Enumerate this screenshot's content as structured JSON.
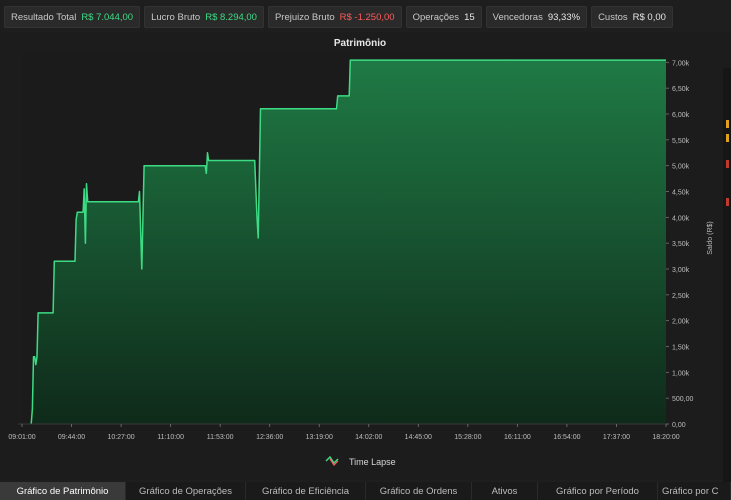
{
  "stats": [
    {
      "label": "Resultado Total",
      "value": "R$ 7.044,00",
      "tone": "pos"
    },
    {
      "label": "Lucro Bruto",
      "value": "R$ 8.294,00",
      "tone": "pos"
    },
    {
      "label": "Prejuizo Bruto",
      "value": "R$ -1.250,00",
      "tone": "neg"
    },
    {
      "label": "Operações",
      "value": "15",
      "tone": "neu"
    },
    {
      "label": "Vencedoras",
      "value": "93,33%",
      "tone": "neu"
    },
    {
      "label": "Custos",
      "value": "R$ 0,00",
      "tone": "neu"
    }
  ],
  "chart": {
    "title": "Patrimônio",
    "ylabel": "Saldo (R$)",
    "legend": "Time Lapse"
  },
  "chart_data": {
    "type": "area",
    "title": "Patrimônio",
    "xlabel": "",
    "ylabel": "Saldo (R$)",
    "ylim": [
      0,
      7200
    ],
    "y_ticks": [
      0,
      500,
      1000,
      1500,
      2000,
      2500,
      3000,
      3500,
      4000,
      4500,
      5000,
      5500,
      6000,
      6500,
      7000
    ],
    "y_tick_labels": [
      "0,00",
      "500,00",
      "1,00k",
      "1,50k",
      "2,00k",
      "2,50k",
      "3,00k",
      "3,50k",
      "4,00k",
      "4,50k",
      "5,00k",
      "5,50k",
      "6,00k",
      "6,50k",
      "7,00k"
    ],
    "x_tick_labels": [
      "09:01:00",
      "09:44:00",
      "10:27:00",
      "11:10:00",
      "11:53:00",
      "12:36:00",
      "13:19:00",
      "14:02:00",
      "14:45:00",
      "15:28:00",
      "16:11:00",
      "16:54:00",
      "17:37:00",
      "18:20:00"
    ],
    "x_tick_minutes": [
      541,
      584,
      627,
      670,
      713,
      756,
      799,
      842,
      885,
      928,
      971,
      1014,
      1057,
      1100
    ],
    "xlim_minutes": [
      541,
      1100
    ],
    "series": [
      {
        "name": "Time Lapse",
        "color": "#3ddc84",
        "points": [
          [
            549,
            0
          ],
          [
            550,
            300
          ],
          [
            551,
            1300
          ],
          [
            552,
            1300
          ],
          [
            553,
            1150
          ],
          [
            554,
            1300
          ],
          [
            555,
            2150
          ],
          [
            568,
            2150
          ],
          [
            569,
            3150
          ],
          [
            587,
            3150
          ],
          [
            588,
            3950
          ],
          [
            589,
            4100
          ],
          [
            594,
            4100
          ],
          [
            595,
            4550
          ],
          [
            596,
            3500
          ],
          [
            597,
            4650
          ],
          [
            598,
            4300
          ],
          [
            642,
            4300
          ],
          [
            643,
            4500
          ],
          [
            645,
            3000
          ],
          [
            647,
            5000
          ],
          [
            700,
            5000
          ],
          [
            701,
            4850
          ],
          [
            702,
            5250
          ],
          [
            703,
            5100
          ],
          [
            743,
            5100
          ],
          [
            745,
            4000
          ],
          [
            746,
            3600
          ],
          [
            748,
            6100
          ],
          [
            814,
            6100
          ],
          [
            815,
            6350
          ],
          [
            825,
            6350
          ],
          [
            826,
            7044
          ],
          [
            1100,
            7044
          ]
        ]
      }
    ],
    "grid": false,
    "legend_position": "bottom-center"
  },
  "tabs": [
    {
      "label": "Gráfico de Patrimônio",
      "active": true
    },
    {
      "label": "Gráfico de Operações",
      "active": false
    },
    {
      "label": "Gráfico de Eficiência",
      "active": false
    },
    {
      "label": "Gráfico de Ordens",
      "active": false
    },
    {
      "label": "Ativos",
      "active": false
    },
    {
      "label": "Gráfico por Período",
      "active": false
    },
    {
      "label": "Gráfico por C",
      "active": false
    }
  ]
}
